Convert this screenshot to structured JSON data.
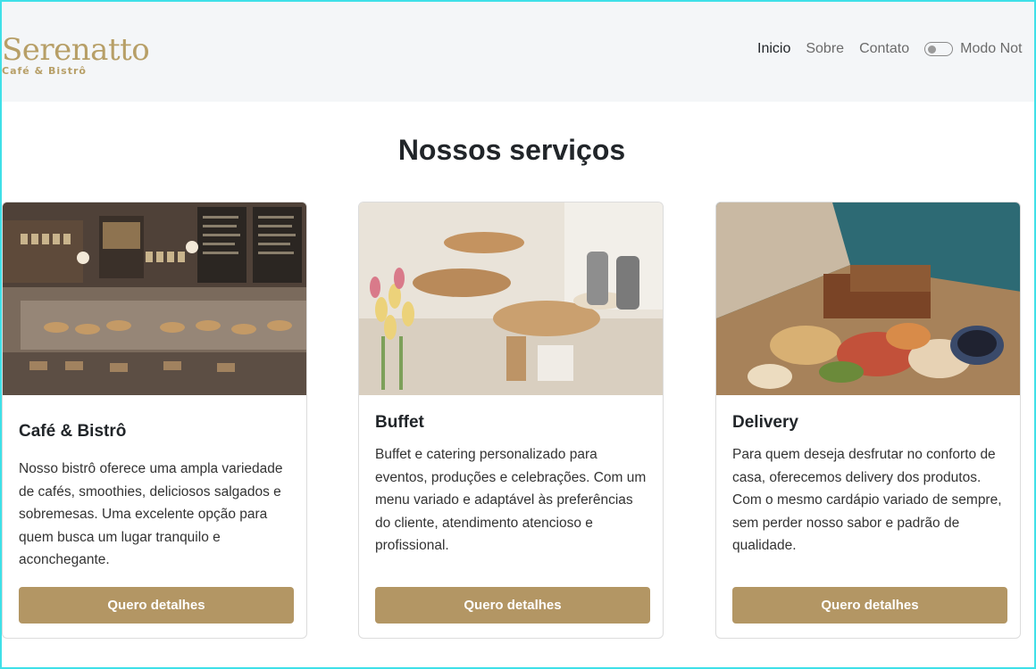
{
  "brand": {
    "name": "Serenatto",
    "tagline": "Café & Bistrô"
  },
  "nav": {
    "items": [
      "Inicio",
      "Sobre",
      "Contato"
    ],
    "active": "Inicio",
    "toggle_label": "Modo Not"
  },
  "section": {
    "title": "Nossos serviços"
  },
  "cards": [
    {
      "title": "Café & Bistrô",
      "text": "Nosso bistrô oferece uma ampla variedade de cafés, smoothies, deliciosos salgados e sobremesas. Uma excelente opção para quem busca um lugar tranquilo e aconchegante.",
      "button": "Quero detalhes",
      "image": "cafe-counter-photo"
    },
    {
      "title": "Buffet",
      "text": "Buffet e catering personalizado para eventos, produções e celebrações. Com um menu variado e adaptável às preferências do cliente, atendimento atencioso e profissional.",
      "button": "Quero detalhes",
      "image": "buffet-table-photo"
    },
    {
      "title": "Delivery",
      "text": "Para quem deseja desfrutar no conforto de casa, oferecemos delivery dos produtos. Com o mesmo cardápio variado de sempre, sem perder nosso sabor e padrão de qualidade.",
      "button": "Quero detalhes",
      "image": "delivery-box-photo"
    }
  ],
  "colors": {
    "brand": "#b79f67",
    "button": "#b39664",
    "header_bg": "#f4f6f8"
  }
}
